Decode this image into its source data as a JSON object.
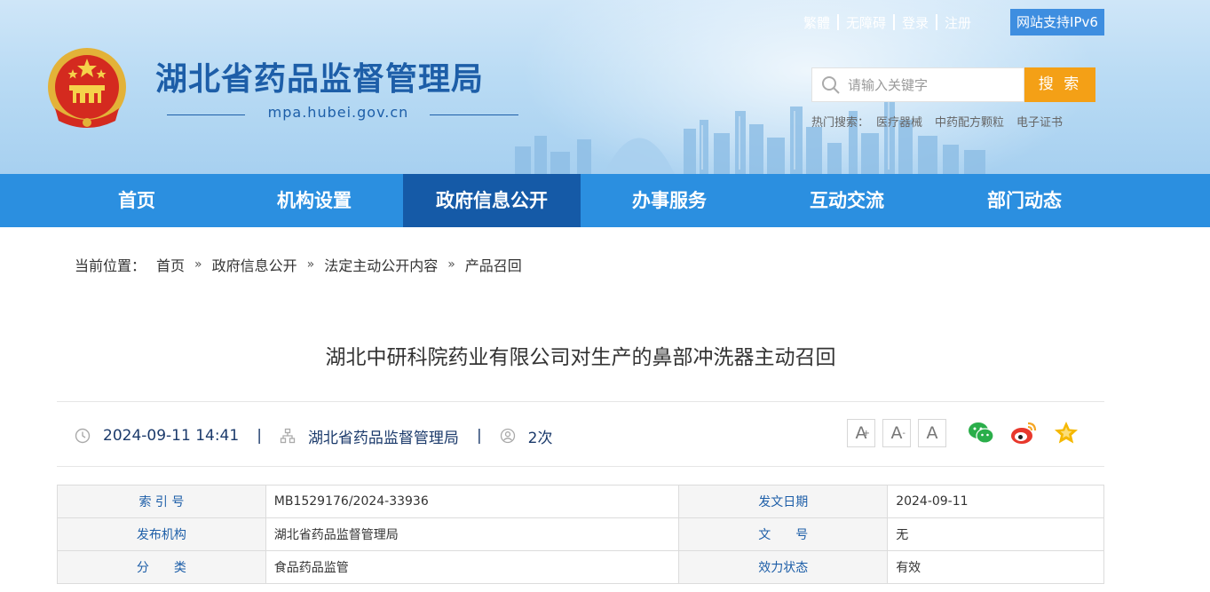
{
  "header": {
    "site_title": "湖北省药品监督管理局",
    "site_domain": "mpa.hubei.gov.cn",
    "top_links": [
      "繁體",
      "无障碍",
      "登录",
      "注册"
    ],
    "ipv6_label": "网站支持IPv6",
    "search": {
      "placeholder": "请输入关键字",
      "button_label": "搜 索"
    },
    "hot_search": {
      "label": "热门搜索：",
      "keywords": [
        "医疗器械",
        "中药配方颗粒",
        "电子证书"
      ]
    }
  },
  "nav": {
    "items": [
      "首页",
      "机构设置",
      "政府信息公开",
      "办事服务",
      "互动交流",
      "部门动态"
    ],
    "active_index": 2
  },
  "breadcrumb": {
    "prefix": "当前位置：",
    "items": [
      "首页",
      "政府信息公开",
      "法定主动公开内容",
      "产品召回"
    ],
    "separator": "»"
  },
  "article": {
    "title": "湖北中研科院药业有限公司对生产的鼻部冲洗器主动召回",
    "meta": {
      "datetime": "2024-09-11 14:41",
      "publisher": "湖北省药品监督管理局",
      "views": "2次",
      "separator": "|"
    },
    "font_buttons": [
      {
        "letter": "A",
        "mark": "+"
      },
      {
        "letter": "A",
        "mark": "-"
      },
      {
        "letter": "A",
        "mark": ""
      }
    ],
    "share_icons": [
      "wechat-icon",
      "weibo-icon",
      "favorite-star-icon"
    ]
  },
  "info_table": {
    "rows": [
      {
        "label1": "索 引 号",
        "value1": "MB1529176/2024-33936",
        "label2": "发文日期",
        "value2": "2024-09-11"
      },
      {
        "label1": "发布机构",
        "value1": "湖北省药品监督管理局",
        "label2": "文　　号",
        "value2": "无"
      },
      {
        "label1": "分　　类",
        "value1": "食品药品监管",
        "label2": "效力状态",
        "value2": "有效"
      }
    ]
  },
  "colors": {
    "brand_blue": "#1d5ea8",
    "nav_blue": "#2b8fe0",
    "nav_active": "#155aa7",
    "search_orange": "#f4a016",
    "ipv6_blue": "#3e8ee0"
  }
}
